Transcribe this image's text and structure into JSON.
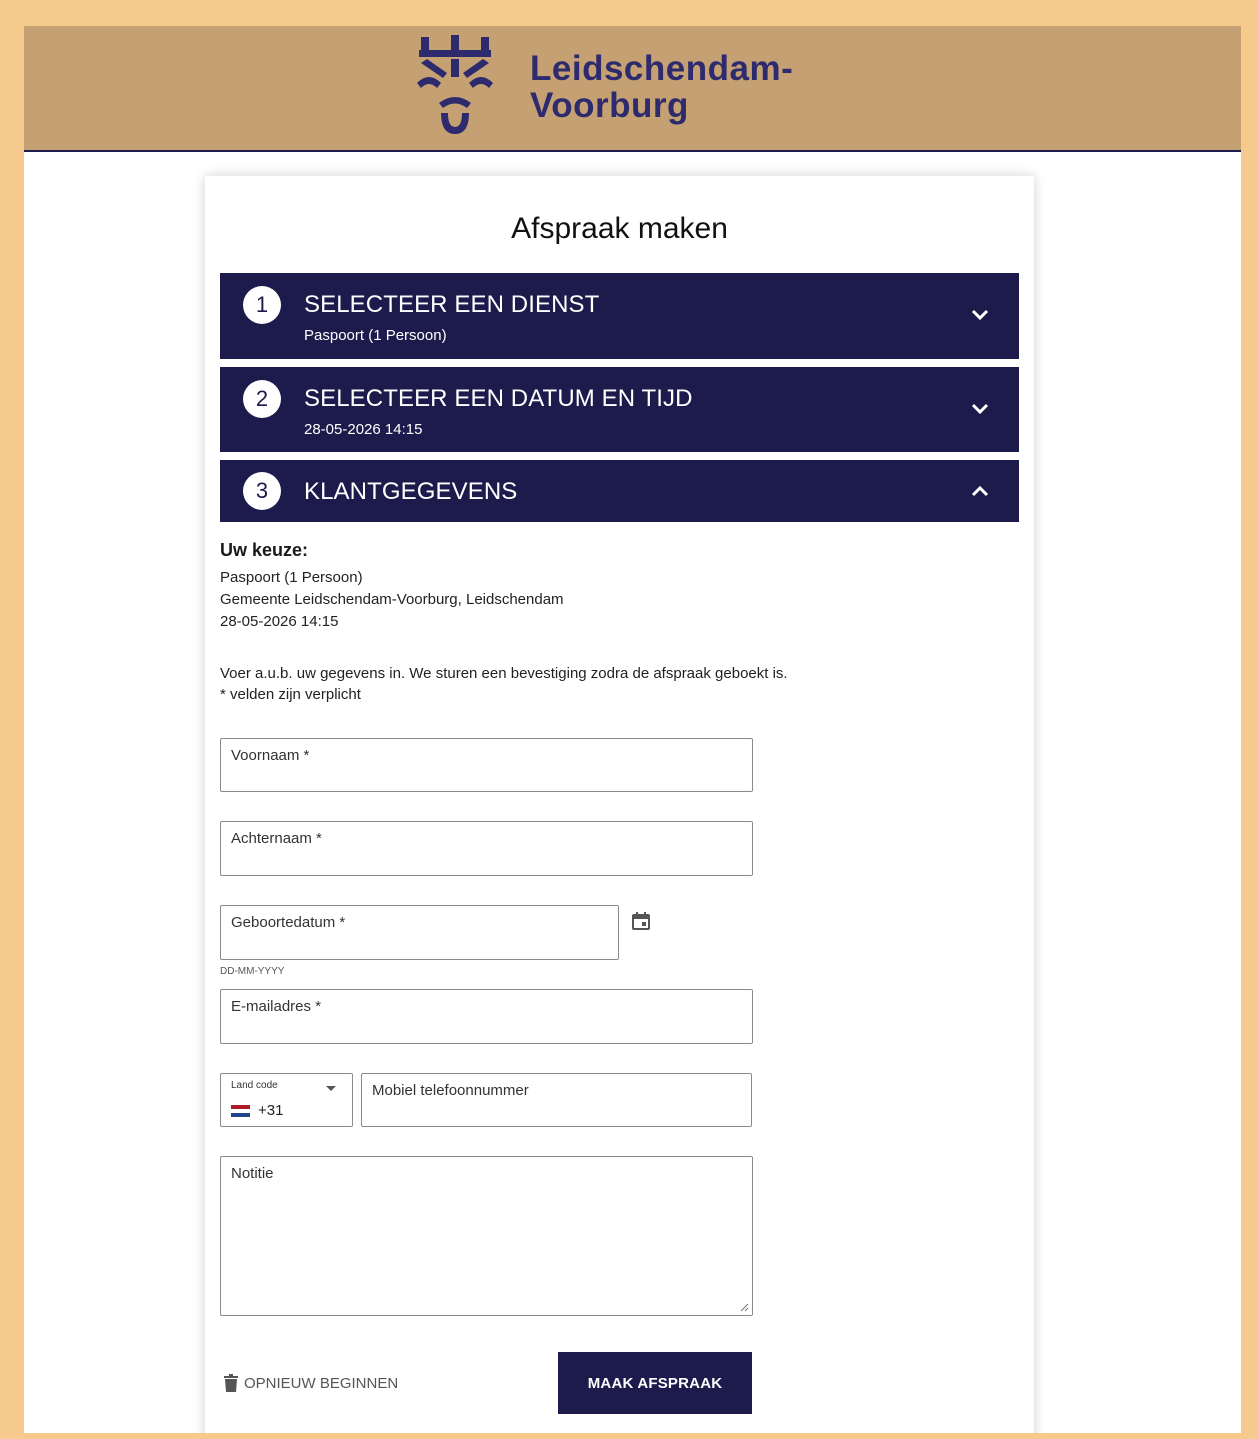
{
  "colors": {
    "brand_dark": "#1d1b4c",
    "header_bg": "#c4a072",
    "outer_border": "#f6c98d"
  },
  "header": {
    "logo_icon": "municipal-crown-icon",
    "logo_line1": "Leidschendam-",
    "logo_line2": "Voorburg"
  },
  "page_title": "Afspraak maken",
  "steps": [
    {
      "number": "1",
      "title": "SELECTEER EEN DIENST",
      "subtitle": "Paspoort (1 Persoon)",
      "state": "collapsed",
      "icon": "chevron-down-icon"
    },
    {
      "number": "2",
      "title": "SELECTEER EEN DATUM EN TIJD",
      "subtitle": "28-05-2026 14:15",
      "state": "collapsed",
      "icon": "chevron-down-icon"
    },
    {
      "number": "3",
      "title": "KLANTGEGEVENS",
      "state": "expanded",
      "icon": "chevron-up-icon"
    }
  ],
  "choice": {
    "heading": "Uw keuze:",
    "lines": [
      "Paspoort (1 Persoon)",
      "Gemeente Leidschendam-Voorburg, Leidschendam",
      "28-05-2026 14:15"
    ]
  },
  "instructions": {
    "line1": "Voer a.u.b. uw gegevens in. We sturen een bevestiging zodra de afspraak geboekt is.",
    "line2": "* velden zijn verplicht"
  },
  "form": {
    "first_name": {
      "label": "Voornaam *",
      "value": ""
    },
    "last_name": {
      "label": "Achternaam *",
      "value": ""
    },
    "birthdate": {
      "label": "Geboortedatum *",
      "value": "",
      "hint": "DD-MM-YYYY",
      "icon": "calendar-icon"
    },
    "email": {
      "label": "E-mailadres *",
      "value": ""
    },
    "country_code": {
      "label": "Land code",
      "value": "+31",
      "flag": "netherlands-flag-icon"
    },
    "phone": {
      "label": "Mobiel telefoonnummer",
      "value": ""
    },
    "note": {
      "label": "Notitie",
      "value": ""
    }
  },
  "actions": {
    "reset_label": "OPNIEUW BEGINNEN",
    "reset_icon": "trash-icon",
    "submit_label": "MAAK AFSPRAAK"
  }
}
